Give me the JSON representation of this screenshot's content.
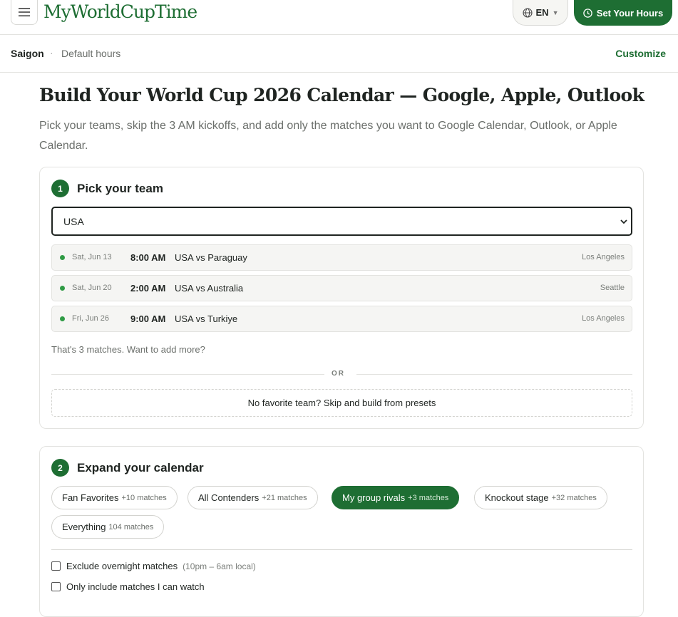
{
  "header": {
    "logo": "MyWorldCupTime",
    "language": "EN",
    "set_hours_label": "Set Your Hours"
  },
  "subbar": {
    "city": "Saigon",
    "separator": "·",
    "hours_label": "Default hours",
    "customize_label": "Customize"
  },
  "main": {
    "title": "Build Your World Cup 2026 Calendar — Google, Apple, Outlook",
    "subtitle": "Pick your teams, skip the 3 AM kickoffs, and add only the matches you want to Google Calendar, Outlook, or Apple Calendar."
  },
  "step1": {
    "number": "1",
    "title": "Pick your team",
    "selected_team": "USA",
    "matches": [
      {
        "date": "Sat, Jun 13",
        "time": "8:00 AM",
        "teams": "USA vs Paraguay",
        "venue": "Los Angeles"
      },
      {
        "date": "Sat, Jun 20",
        "time": "2:00 AM",
        "teams": "USA vs Australia",
        "venue": "Seattle"
      },
      {
        "date": "Fri, Jun 26",
        "time": "9:00 AM",
        "teams": "USA vs Turkiye",
        "venue": "Los Angeles"
      }
    ],
    "count_note": "That's 3 matches. Want to add more?",
    "or_label": "OR",
    "skip_label": "No favorite team? Skip and build from presets"
  },
  "step2": {
    "number": "2",
    "title": "Expand your calendar",
    "presets": [
      {
        "label": "Fan Favorites",
        "count": "+10 matches",
        "active": false
      },
      {
        "label": "All Contenders",
        "count": "+21 matches",
        "active": false
      },
      {
        "label": "My group rivals",
        "count": "+3 matches",
        "active": true
      },
      {
        "label": "Knockout stage",
        "count": "+32 matches",
        "active": false
      },
      {
        "label": "Everything",
        "count": "104 matches",
        "active": false
      }
    ],
    "options": [
      {
        "label": "Exclude overnight matches",
        "hint": "(10pm – 6am local)",
        "checked": false
      },
      {
        "label": "Only include matches I can watch",
        "hint": "",
        "checked": false
      }
    ]
  },
  "colors": {
    "brand_green": "#1e6e33",
    "status_dot": "#2f9b45"
  },
  "icons": [
    "menu-icon",
    "globe-icon",
    "chevron-down-icon",
    "clock-icon"
  ]
}
